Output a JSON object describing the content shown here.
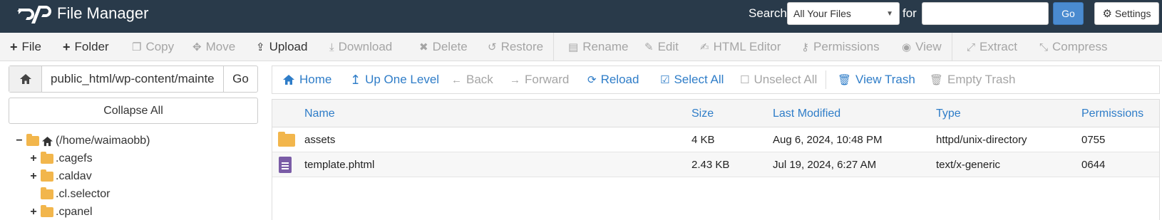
{
  "header": {
    "title": "File Manager",
    "search_label": "Search",
    "search_scope": "All Your Files",
    "for_label": "for",
    "search_value": "",
    "go_label": "Go",
    "settings_label": "Settings"
  },
  "toolbar": {
    "file": "File",
    "folder": "Folder",
    "copy": "Copy",
    "move": "Move",
    "upload": "Upload",
    "download": "Download",
    "delete": "Delete",
    "restore": "Restore",
    "rename": "Rename",
    "edit": "Edit",
    "html_editor": "HTML Editor",
    "permissions": "Permissions",
    "view": "View",
    "extract": "Extract",
    "compress": "Compress"
  },
  "left": {
    "path_value": "public_html/wp-content/mainte",
    "go_label": "Go",
    "collapse_label": "Collapse All",
    "tree": {
      "root": "(/home/waimaobb)",
      "items": [
        ".cagefs",
        ".caldav",
        ".cl.selector",
        ".cpanel"
      ]
    }
  },
  "nav": {
    "home": "Home",
    "up": "Up One Level",
    "back": "Back",
    "forward": "Forward",
    "reload": "Reload",
    "select_all": "Select All",
    "unselect_all": "Unselect All",
    "view_trash": "View Trash",
    "empty_trash": "Empty Trash"
  },
  "table": {
    "columns": [
      "Name",
      "Size",
      "Last Modified",
      "Type",
      "Permissions"
    ],
    "rows": [
      {
        "name": "assets",
        "size": "4 KB",
        "modified": "Aug 6, 2024, 10:48 PM",
        "type": "httpd/unix-directory",
        "perms": "0755",
        "icon": "folder-icon"
      },
      {
        "name": "template.phtml",
        "size": "2.43 KB",
        "modified": "Jul 19, 2024, 6:27 AM",
        "type": "text/x-generic",
        "perms": "0644",
        "icon": "text-file-icon"
      }
    ]
  }
}
